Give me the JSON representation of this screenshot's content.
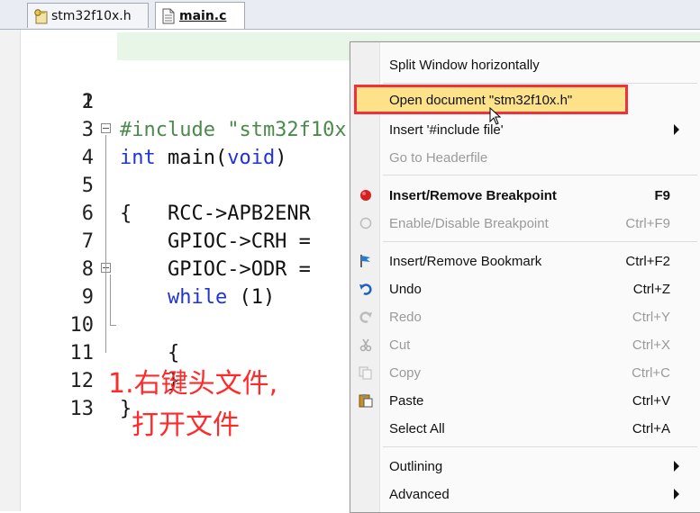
{
  "tabs": [
    {
      "label": "stm32f10x.h",
      "icon": "key-header-file-icon"
    },
    {
      "label": "main.c",
      "icon": "document-icon",
      "active": true
    }
  ],
  "code_lines": [
    {
      "num": "1",
      "text": "#include \"stm32f10x.h\"",
      "comment": "//"
    },
    {
      "num": "2",
      "text": ""
    },
    {
      "num": "3",
      "text": "int main(void)"
    },
    {
      "num": "4",
      "text": "{"
    },
    {
      "num": "5",
      "text": "    RCC->APB2ENR"
    },
    {
      "num": "6",
      "text": "    GPIOC->CRH ="
    },
    {
      "num": "7",
      "text": "    GPIOC->ODR ="
    },
    {
      "num": "8",
      "text": "    while (1)"
    },
    {
      "num": "9",
      "text": "    {"
    },
    {
      "num": "10",
      "text": ""
    },
    {
      "num": "11",
      "text": "    }"
    },
    {
      "num": "12",
      "text": "}"
    },
    {
      "num": "13",
      "text": ""
    }
  ],
  "annotation": {
    "line1": "1.右键头文件,",
    "line2": "打开文件"
  },
  "menu": {
    "split_window": "Split Window horizontally",
    "open_document": "Open document \"stm32f10x.h\"",
    "insert_include": "Insert '#include file'",
    "goto_header": "Go to Headerfile",
    "breakpoint": {
      "label": "Insert/Remove Breakpoint",
      "shortcut": "F9"
    },
    "enable_breakpoint": {
      "label": "Enable/Disable Breakpoint",
      "shortcut": "Ctrl+F9"
    },
    "bookmark": {
      "label": "Insert/Remove Bookmark",
      "shortcut": "Ctrl+F2"
    },
    "undo": {
      "label": "Undo",
      "shortcut": "Ctrl+Z"
    },
    "redo": {
      "label": "Redo",
      "shortcut": "Ctrl+Y"
    },
    "cut": {
      "label": "Cut",
      "shortcut": "Ctrl+X"
    },
    "copy": {
      "label": "Copy",
      "shortcut": "Ctrl+C"
    },
    "paste": {
      "label": "Paste",
      "shortcut": "Ctrl+V"
    },
    "select_all": {
      "label": "Select All",
      "shortcut": "Ctrl+A"
    },
    "outlining": "Outlining",
    "advanced": "Advanced"
  },
  "colors": {
    "keyword": "#1f33d6",
    "preprocessor": "#4a8a4a",
    "annotation": "#ff2a2a",
    "highlight": "#fde28a",
    "redbox": "#f2303a"
  }
}
